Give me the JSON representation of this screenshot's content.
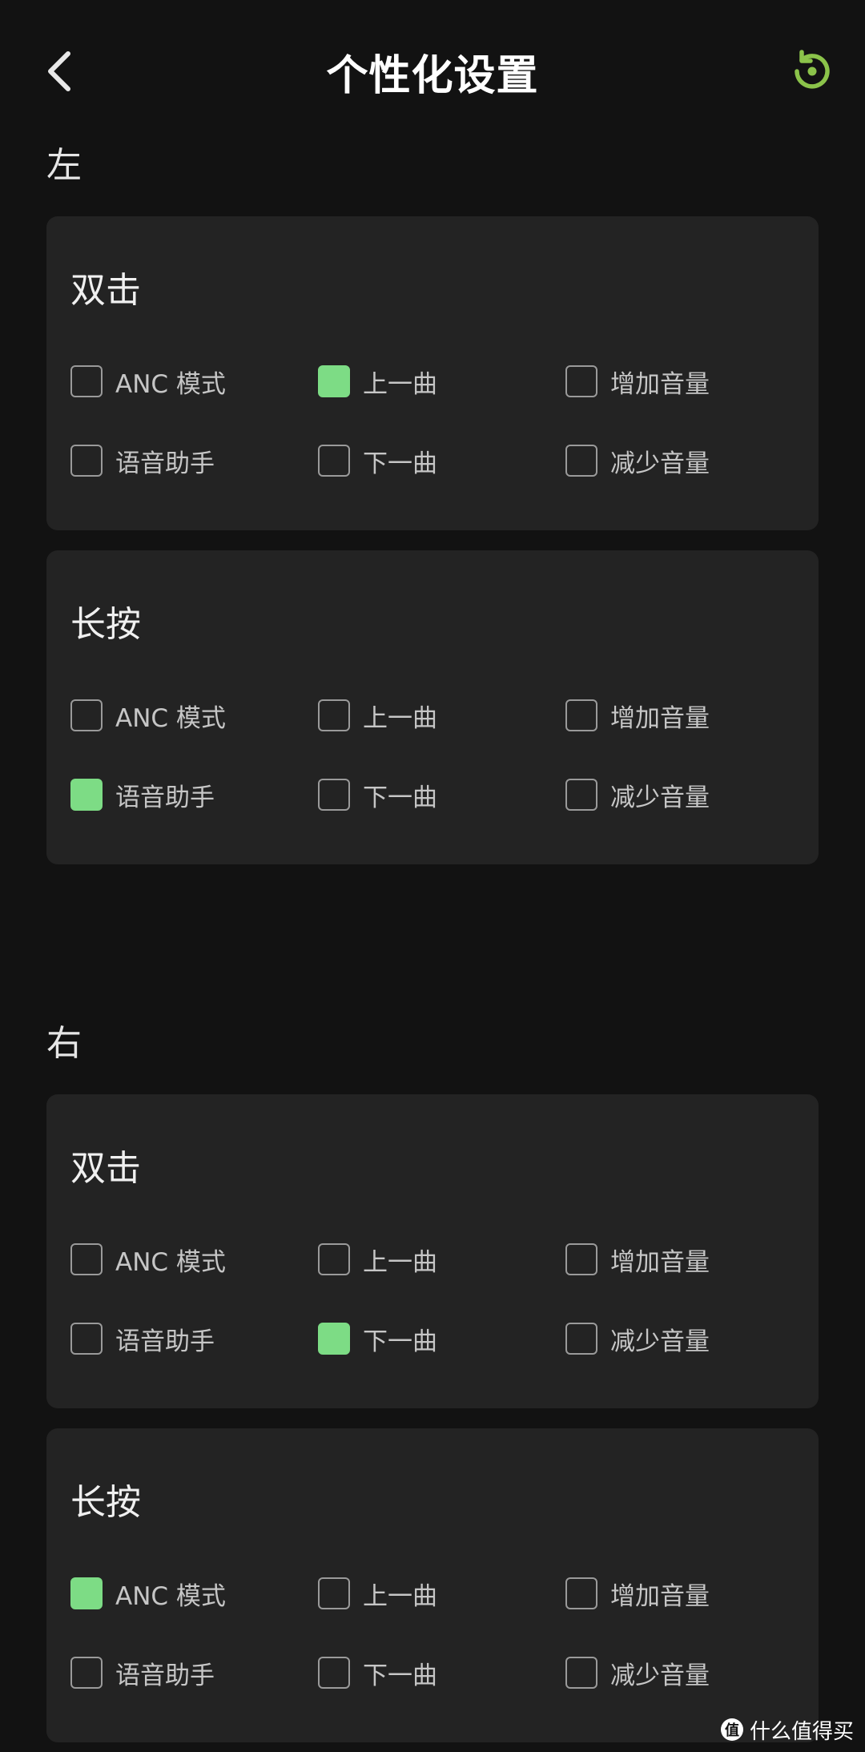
{
  "header": {
    "title": "个性化设置",
    "back_icon": "chevron-left-icon",
    "reset_icon": "restore-icon",
    "accent_color": "#8bc34a"
  },
  "option_labels": [
    "ANC 模式",
    "上一曲",
    "增加音量",
    "语音助手",
    "下一曲",
    "减少音量"
  ],
  "check_color": "#7ddc85",
  "sections": [
    {
      "label": "左",
      "cards": [
        {
          "title": "双击",
          "selected": "上一曲"
        },
        {
          "title": "长按",
          "selected": "语音助手"
        }
      ]
    },
    {
      "label": "右",
      "cards": [
        {
          "title": "双击",
          "selected": "下一曲"
        },
        {
          "title": "长按",
          "selected": "ANC 模式"
        }
      ]
    }
  ],
  "watermark": {
    "text": "什么值得买",
    "badge": "值"
  }
}
